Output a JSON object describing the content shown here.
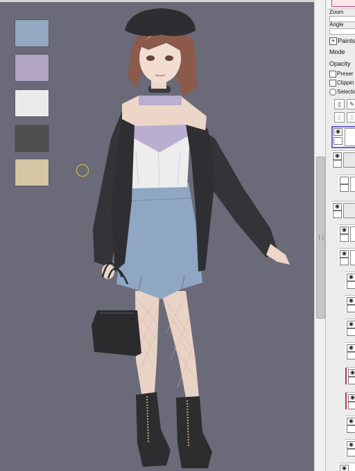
{
  "swatches": [
    {
      "name": "blue",
      "color": "#93a8c1"
    },
    {
      "name": "lavender",
      "color": "#b3a5c4"
    },
    {
      "name": "white",
      "color": "#eaeaea"
    },
    {
      "name": "dark-gray",
      "color": "#4e4e4e"
    },
    {
      "name": "tan",
      "color": "#d6c6a4"
    }
  ],
  "panel": {
    "zoom_label": "Zoom",
    "angle_label": "Angle",
    "paints_label": "Paints",
    "mode_label": "Mode",
    "opacity_label": "Opacity",
    "preserve_label": "Preser",
    "clipping_label": "Clippin",
    "selection_label": "Selectio"
  },
  "colors": {
    "canvas": "#6b6a78",
    "skirt": "#8fa7c3",
    "jacket": "#2f2f33",
    "top": "#b9aed0",
    "accent_marker": "#c0304a"
  }
}
